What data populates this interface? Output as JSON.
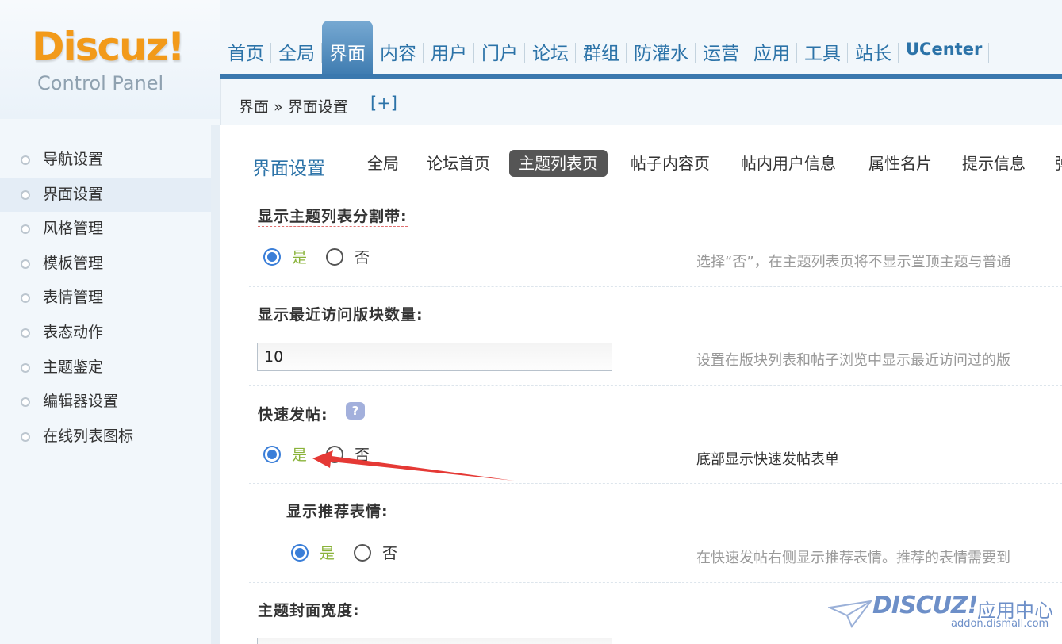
{
  "logo": {
    "brand": "Discuz!",
    "subtitle": "Control Panel"
  },
  "top_nav": {
    "items": [
      "首页",
      "全局",
      "界面",
      "内容",
      "用户",
      "门户",
      "论坛",
      "群组",
      "防灌水",
      "运营",
      "应用",
      "工具",
      "站长",
      "UCenter"
    ],
    "active": "界面"
  },
  "breadcrumb": {
    "text": "界面 » 界面设置",
    "expand": "[+]"
  },
  "sidebar": {
    "items": [
      "导航设置",
      "界面设置",
      "风格管理",
      "模板管理",
      "表情管理",
      "表态动作",
      "主题鉴定",
      "编辑器设置",
      "在线列表图标"
    ],
    "active": "界面设置"
  },
  "tabs": {
    "title": "界面设置",
    "items": [
      "全局",
      "论坛首页",
      "主题列表页",
      "帖子内容页",
      "帖内用户信息",
      "属性名片",
      "提示信息",
      "弹"
    ],
    "active": "主题列表页"
  },
  "form": {
    "yes": "是",
    "no": "否",
    "s1": {
      "label": "显示主题列表分割带:",
      "desc": "选择“否”，在主题列表页将不显示置顶主题与普通"
    },
    "s2": {
      "label": "显示最近访问版块数量:",
      "value": "10",
      "desc": "设置在版块列表和帖子浏览中显示最近访问过的版"
    },
    "s3": {
      "label": "快速发帖:",
      "help": "?",
      "desc": "底部显示快速发帖表单"
    },
    "s4": {
      "label": "显示推荐表情:",
      "desc": "在快速发帖右侧显示推荐表情。推荐的表情需要到"
    },
    "s5": {
      "label": "主题封面宽度:"
    }
  },
  "watermark": {
    "brand": "DISCUZ!",
    "center": "应用中心",
    "domain": "addon.dismall.com"
  },
  "colors": {
    "accent": "#2c73a8",
    "nav_active": "#3a78ae",
    "arrow": "#e53935",
    "radio": "#3a7ed8",
    "logo": "#f29a1a"
  }
}
